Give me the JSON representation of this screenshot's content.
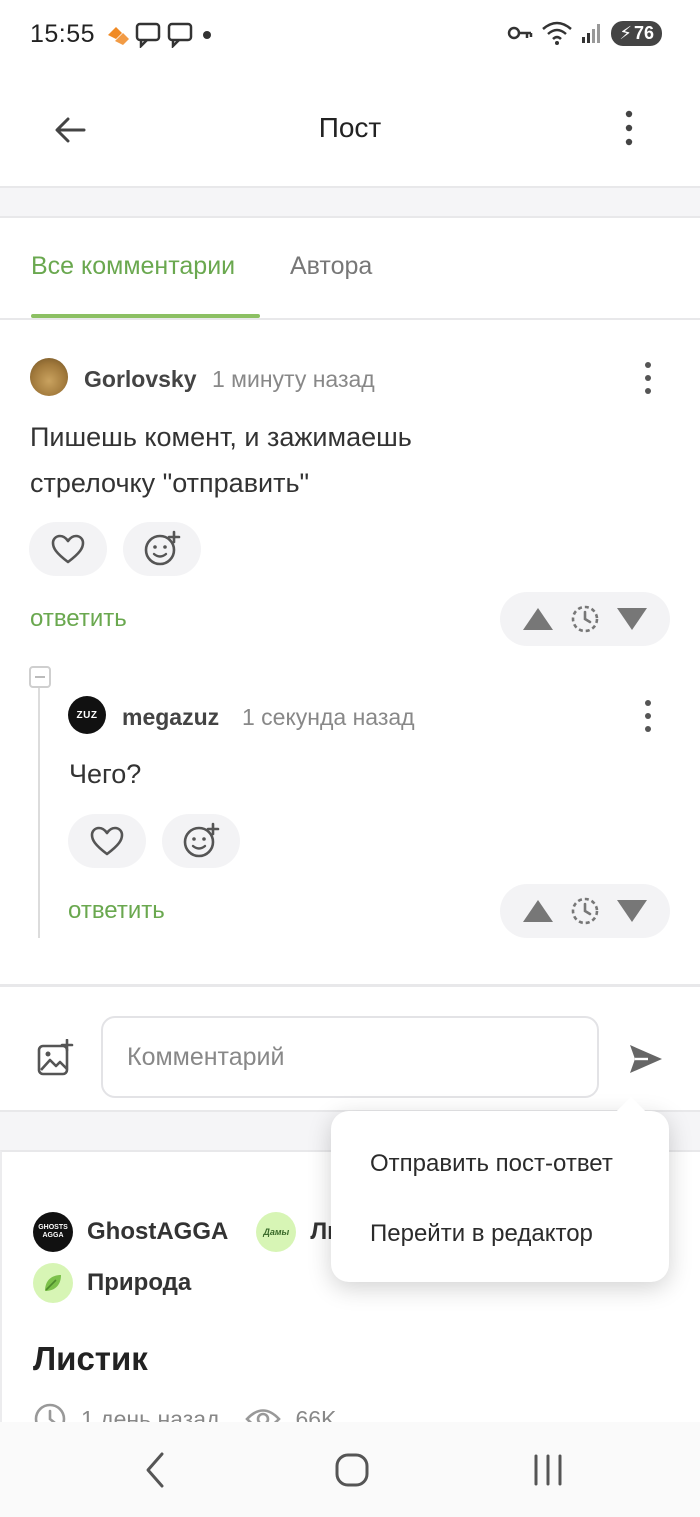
{
  "status_bar": {
    "time": "15:55",
    "battery": "76"
  },
  "app_bar": {
    "title": "Пост"
  },
  "tabs": [
    {
      "label": "Все комментарии",
      "active": true
    },
    {
      "label": "Автора",
      "active": false
    }
  ],
  "comments": [
    {
      "author": "Gorlovsky",
      "time": "1 минуту назад",
      "text_lines": [
        "Пишешь комент, и зажимаешь",
        "стрелочку \"отправить\""
      ],
      "reply_label": "ответить"
    },
    {
      "author": "megazuz",
      "avatar_text": "ZUZ",
      "time": "1 секунда назад",
      "text_lines": [
        "Чего?"
      ],
      "reply_label": "ответить"
    }
  ],
  "composer": {
    "placeholder": "Комментарий"
  },
  "popup_menu": {
    "items": [
      "Отправить пост-ответ",
      "Перейти в редактор"
    ]
  },
  "post_preview": {
    "communities": [
      {
        "name": "GhostAGGA",
        "icon_text": "GHOSTS AGGA"
      },
      {
        "name": "Ли",
        "icon_text": "Дамы"
      },
      {
        "name": "Природа"
      }
    ],
    "title": "Листик",
    "time": "1 день назад",
    "views": "66K"
  },
  "colors": {
    "accent_green": "#6aa84f",
    "tab_underline": "#8cc063"
  }
}
